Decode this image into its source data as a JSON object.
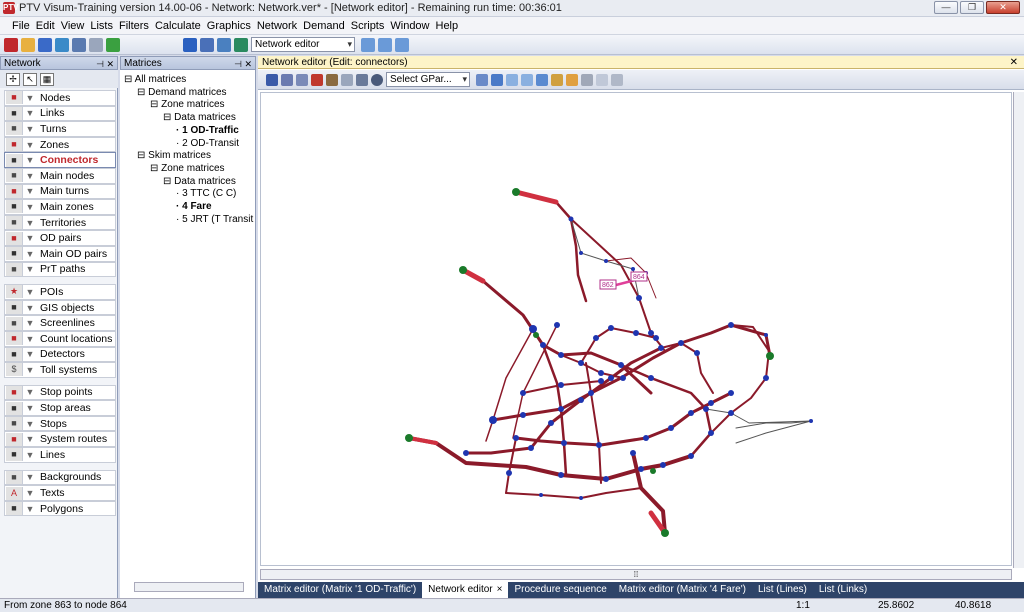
{
  "app": {
    "title": "PTV Visum-Training version 14.00-06 - Network: Network.ver* - [Network editor] - Remaining run time: 00:36:01",
    "logo": "PTV"
  },
  "menu": [
    "File",
    "Edit",
    "View",
    "Lists",
    "Filters",
    "Calculate",
    "Graphics",
    "Network",
    "Demand",
    "Scripts",
    "Window",
    "Help"
  ],
  "toolbar": {
    "mode_select": "Network editor"
  },
  "network_pane": {
    "title": "Network",
    "items": [
      {
        "label": "Nodes",
        "icon": "node-icon"
      },
      {
        "label": "Links",
        "icon": "link-icon"
      },
      {
        "label": "Turns",
        "icon": "turn-icon"
      },
      {
        "label": "Zones",
        "icon": "zone-icon"
      },
      {
        "label": "Connectors",
        "icon": "connector-icon",
        "active": true
      },
      {
        "label": "Main nodes",
        "icon": "main-node-icon"
      },
      {
        "label": "Main turns",
        "icon": "main-turn-icon"
      },
      {
        "label": "Main zones",
        "icon": "main-zone-icon"
      },
      {
        "label": "Territories",
        "icon": "territory-icon"
      },
      {
        "label": "OD pairs",
        "icon": "od-pair-icon"
      },
      {
        "label": "Main OD pairs",
        "icon": "main-od-pair-icon"
      },
      {
        "label": "PrT paths",
        "icon": "prt-path-icon"
      },
      {
        "label": "POIs",
        "icon": "star-icon"
      },
      {
        "label": "GIS objects",
        "icon": "gis-icon"
      },
      {
        "label": "Screenlines",
        "icon": "screenline-icon"
      },
      {
        "label": "Count locations",
        "icon": "count-location-icon"
      },
      {
        "label": "Detectors",
        "icon": "detector-icon"
      },
      {
        "label": "Toll systems",
        "icon": "dollar-icon"
      },
      {
        "label": "Stop points",
        "icon": "stop-point-icon"
      },
      {
        "label": "Stop areas",
        "icon": "stop-area-icon"
      },
      {
        "label": "Stops",
        "icon": "stop-icon"
      },
      {
        "label": "System routes",
        "icon": "system-route-icon"
      },
      {
        "label": "Lines",
        "icon": "line-icon"
      },
      {
        "label": "Backgrounds",
        "icon": "background-icon"
      },
      {
        "label": "Texts",
        "icon": "text-icon"
      },
      {
        "label": "Polygons",
        "icon": "polygon-icon"
      }
    ]
  },
  "matrices_pane": {
    "title": "Matrices",
    "tree": [
      {
        "label": "All matrices",
        "level": 0,
        "prefix": "⊟"
      },
      {
        "label": "Demand matrices",
        "level": 1,
        "prefix": "⊟"
      },
      {
        "label": "Zone matrices",
        "level": 2,
        "prefix": "⊟"
      },
      {
        "label": "Data matrices",
        "level": 3,
        "prefix": "⊟"
      },
      {
        "label": "1 OD-Traffic",
        "level": 4,
        "bold": true
      },
      {
        "label": "2 OD-Transit",
        "level": 4
      },
      {
        "label": "Skim matrices",
        "level": 1,
        "prefix": "⊟"
      },
      {
        "label": "Zone matrices",
        "level": 2,
        "prefix": "⊟"
      },
      {
        "label": "Data matrices",
        "level": 3,
        "prefix": "⊟"
      },
      {
        "label": "3 TTC (C C)",
        "level": 4
      },
      {
        "label": "4 Fare",
        "level": 4,
        "bold": true
      },
      {
        "label": "5 JRT (T Transit",
        "level": 4
      }
    ]
  },
  "editor": {
    "header": "Network editor (Edit: connectors)",
    "gpar_select": "Select GPar...",
    "map_labels": [
      "862",
      "864"
    ]
  },
  "tabs": [
    {
      "label": "Matrix editor (Matrix '1 OD-Traffic')"
    },
    {
      "label": "Network editor",
      "active": true,
      "close": "×"
    },
    {
      "label": "Procedure sequence"
    },
    {
      "label": "Matrix editor (Matrix '4 Fare')"
    },
    {
      "label": "List (Lines)"
    },
    {
      "label": "List (Links)"
    }
  ],
  "status": {
    "message": "From zone 863 to node 864",
    "scale": "1:1",
    "x": "25.8602",
    "y": "40.8618"
  },
  "colors": {
    "link": "#8b1a2a",
    "node": "#1f35b0",
    "zone": "#1a7a2a",
    "highlight": "#e0409a"
  }
}
